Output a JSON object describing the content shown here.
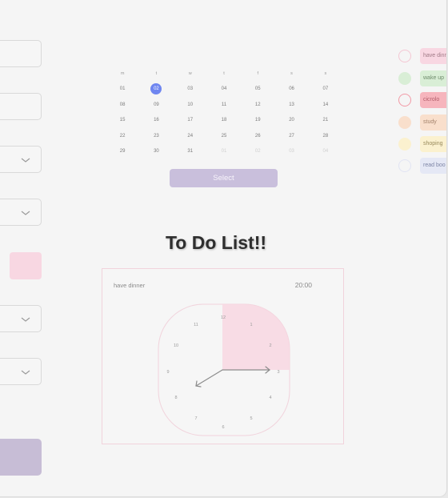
{
  "calendar": {
    "weekdays": [
      "m",
      "t",
      "w",
      "t",
      "f",
      "s",
      "s"
    ],
    "weeks": [
      [
        "01",
        "02",
        "03",
        "04",
        "05",
        "06",
        "07"
      ],
      [
        "08",
        "09",
        "10",
        "11",
        "12",
        "13",
        "14"
      ],
      [
        "15",
        "16",
        "17",
        "18",
        "19",
        "20",
        "21"
      ],
      [
        "22",
        "23",
        "24",
        "25",
        "26",
        "27",
        "28"
      ],
      [
        "29",
        "30",
        "31",
        "01",
        "02",
        "03",
        "04"
      ]
    ],
    "selected_day": "02",
    "select_label": "Select"
  },
  "title": "To Do List!!",
  "current_task": {
    "name": "have dinner",
    "time": "20:00",
    "clock_numbers": [
      "12",
      "1",
      "2",
      "3",
      "4",
      "5",
      "6",
      "7",
      "8",
      "9",
      "10",
      "11"
    ]
  },
  "tasks": [
    {
      "label": "have dinner",
      "color": "#f8d7e2",
      "circle": "#f4c7d3",
      "text_color": "#a07a86",
      "done": false
    },
    {
      "label": "wake up",
      "color": "#d9eed6",
      "circle": "#d9eed6",
      "text_color": "#6f8c6c",
      "done": true
    },
    {
      "label": "cicrolo",
      "color": "#f6b5bd",
      "circle": "#f29aa6",
      "text_color": "#b25d69",
      "done": false
    },
    {
      "label": "study",
      "color": "#f9dfcc",
      "circle": "#f9dfcc",
      "text_color": "#a3826b",
      "done": true
    },
    {
      "label": "shoping",
      "color": "#fbf1cf",
      "circle": "#fbf1cf",
      "text_color": "#98895a",
      "done": true
    },
    {
      "label": "read boo",
      "color": "#e5e8f5",
      "circle": "#e1e4f3",
      "text_color": "#7e86a6",
      "done": false
    }
  ],
  "colors": {
    "accent": "#6f86f0",
    "select_button": "#c9bfdc",
    "clock_fill": "#f8d7e2"
  }
}
